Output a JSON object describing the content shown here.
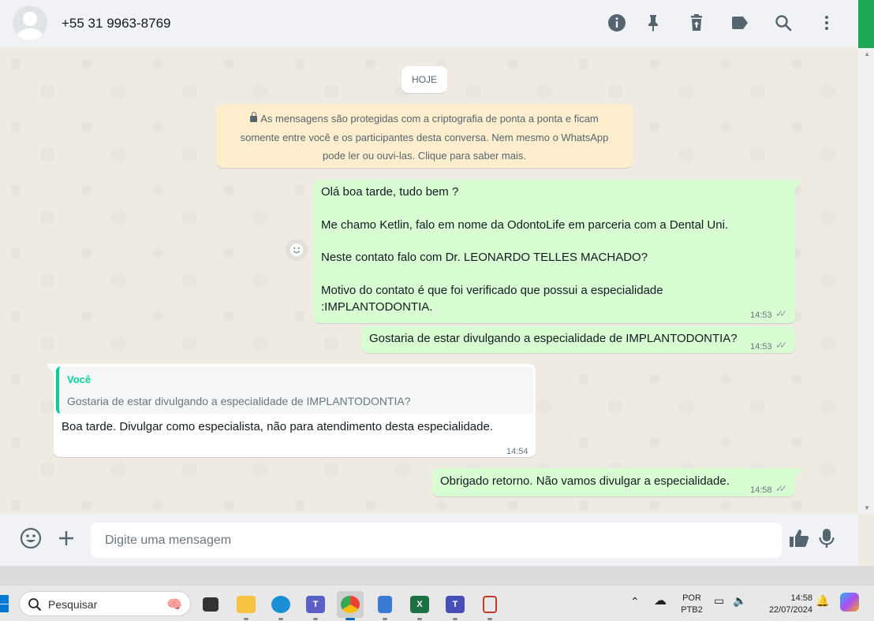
{
  "header": {
    "contact_name": "+55 31 9963-8769",
    "icons": [
      "info-icon",
      "pin-icon",
      "delete-icon",
      "label-icon",
      "search-icon",
      "menu-icon"
    ]
  },
  "chat": {
    "day_chip": "HOJE",
    "encryption_notice": {
      "line1": "As mensagens são protegidas com a criptografia de ponta a ponta e ficam",
      "line2": "somente entre você e os participantes desta conversa. Nem mesmo o WhatsApp",
      "line3": "pode ler ou ouvi-las. Clique para saber mais."
    },
    "messages": [
      {
        "direction": "out",
        "lines": [
          "Olá boa tarde, tudo bem ?",
          "",
          "Me chamo Ketlin, falo em nome da OdontoLife em parceria com a Dental Uni.",
          "",
          "Neste contato falo com Dr. LEONARDO TELLES MACHADO?",
          "",
          "Motivo do contato é que foi verificado que possui a especialidade",
          ":IMPLANTODONTIA."
        ],
        "time": "14:53",
        "status": "read"
      },
      {
        "direction": "out",
        "text": "Gostaria de estar divulgando a especialidade de IMPLANTODONTIA?",
        "time": "14:53",
        "status": "read"
      },
      {
        "direction": "in",
        "quote_author": "Você",
        "quote_text": "Gostaria de estar divulgando a especialidade de IMPLANTODONTIA?",
        "text": "Boa tarde. Divulgar como especialista, não para atendimento desta especialidade.",
        "time": "14:54"
      },
      {
        "direction": "out",
        "text": "Obrigado retorno. Não vamos divulgar a  especialidade.",
        "time": "14:58",
        "status": "read"
      }
    ]
  },
  "composer": {
    "placeholder": "Digite uma mensagem"
  },
  "taskbar": {
    "search_label": "Pesquisar",
    "lang_line1": "POR",
    "lang_line2": "PTB2",
    "clock_time": "14:58",
    "clock_date": "22/07/2024",
    "colors": {
      "accent_green": "#1fa855",
      "outgoing_bubble": "#d9fdd3",
      "quote_bar": "#06cf9c",
      "encryption_bg": "#ffeecd"
    }
  }
}
